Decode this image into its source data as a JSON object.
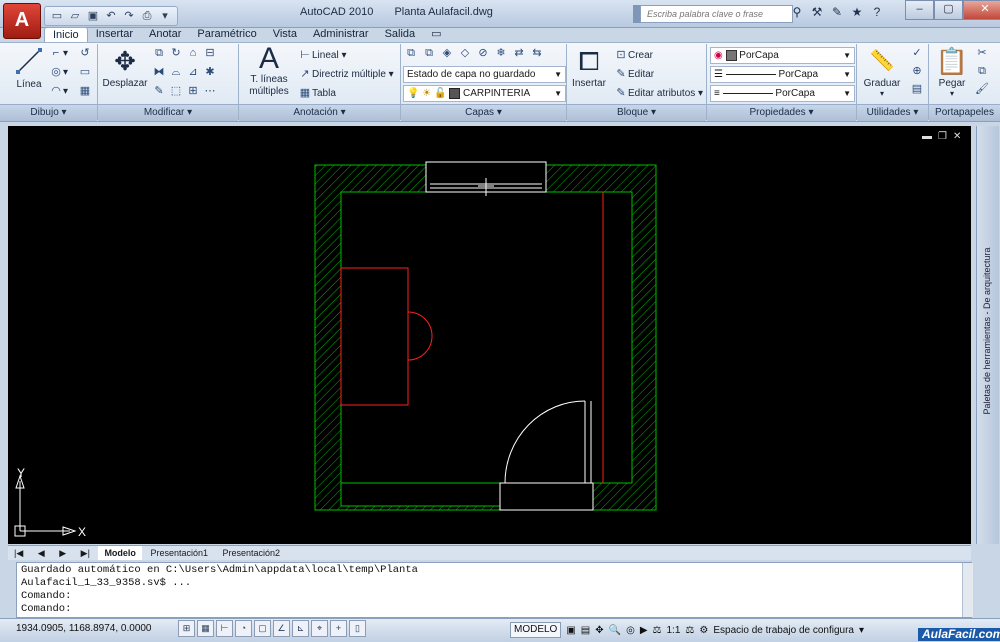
{
  "titlebar": {
    "app": "AutoCAD 2010",
    "file": "Planta Aulafacil.dwg",
    "search_placeholder": "Escriba palabra clave o frase",
    "app_button_letter": "A"
  },
  "tabs": [
    "Inicio",
    "Insertar",
    "Anotar",
    "Paramétrico",
    "Vista",
    "Administrar",
    "Salida"
  ],
  "ribbon": {
    "dibujo": {
      "linea": "Línea",
      "panel": "Dibujo ▾"
    },
    "modificar": {
      "desplazar": "Desplazar",
      "panel": "Modificar ▾"
    },
    "anotacion": {
      "t_lineas": "T. líneas",
      "multiples": "múltiples",
      "lineal": "Lineal",
      "directriz": "Directriz múltiple",
      "tabla": "Tabla",
      "panel": "Anotación ▾"
    },
    "capas": {
      "estado": "Estado de capa no guardado",
      "capa_actual": "CARPINTERIA",
      "panel": "Capas ▾"
    },
    "bloque": {
      "insertar": "Insertar",
      "crear": "Crear",
      "editar": "Editar",
      "editar_atributos": "Editar atributos",
      "panel": "Bloque ▾"
    },
    "propiedades": {
      "color": "PorCapa",
      "tipo_linea": "PorCapa",
      "grosor": "PorCapa",
      "panel": "Propiedades ▾"
    },
    "utilidades": {
      "graduar": "Graduar",
      "panel": "Utilidades ▾"
    },
    "portapapeles": {
      "pegar": "Pegar",
      "panel": "Portapapeles"
    }
  },
  "colors": {
    "wall": "#00c000",
    "red": "#ff2020",
    "white": "#ffffff"
  },
  "canvas": {
    "ucs_y": "Y",
    "ucs_x": "X",
    "side_palette": "Paletas de herramientas - De arquitectura"
  },
  "layout_tabs": [
    "Modelo",
    "Presentación1",
    "Presentación2"
  ],
  "command": {
    "line1": "Guardado automático en C:\\Users\\Admin\\appdata\\local\\temp\\Planta",
    "line2": "Aulafacil_1_33_9358.sv$ ...",
    "line3": "Comando:",
    "line4": "Comando:"
  },
  "status": {
    "coords": "1934.0905, 1168.8974, 0.0000",
    "modelo": "MODELO",
    "scale": "1:1",
    "workspace": "Espacio de trabajo de configura",
    "brand": "AulaFacil.com"
  }
}
